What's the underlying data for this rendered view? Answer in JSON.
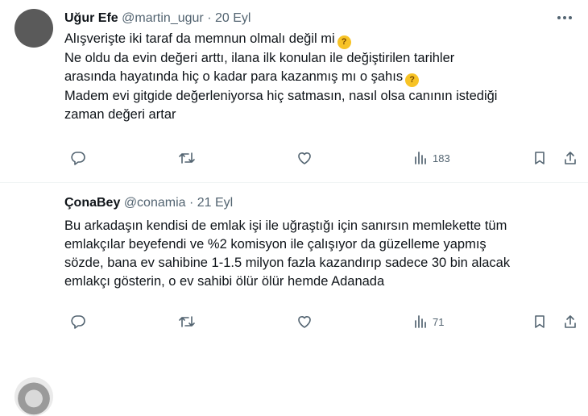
{
  "tweets": [
    {
      "name": "Uğur Efe",
      "handle": "@martin_ugur",
      "separator": "·",
      "date": "20 Eyl",
      "lines": [
        "Alışverişte iki taraf da memnun olmalı değil mi",
        "Ne oldu da evin değeri arttı, ilana ilk konulan ile değiştirilen tarihler",
        "arasında hayatında hiç o kadar para kazanmış mı o şahıs",
        "Madem evi gitgide değerleniyorsa hiç satmasın, nasıl olsa canının istediği",
        "zaman değeri artar"
      ],
      "views": "183",
      "emoji_icon": "thinking-face-icon"
    },
    {
      "name": "ÇonaBey",
      "handle": "@conamia",
      "separator": "·",
      "date": "21 Eyl",
      "lines": [
        "Bu arkadaşın kendisi de emlak işi ile uğraştığı için sanırsın memlekette tüm",
        "emlakçılar beyefendi ve %2 komisyon ile çalışıyor da güzelleme yapmış",
        "sözde, bana ev sahibine 1-1.5 milyon fazla kazandırıp sadece 30 bin alacak",
        "emlakçı gösterin, o ev sahibi ölür ölür hemde Adanada"
      ],
      "views": "71"
    }
  ],
  "colors": {
    "text": "#0f1419",
    "secondary": "#536471",
    "divider": "#eff3f4",
    "emoji": "#f7c326"
  }
}
